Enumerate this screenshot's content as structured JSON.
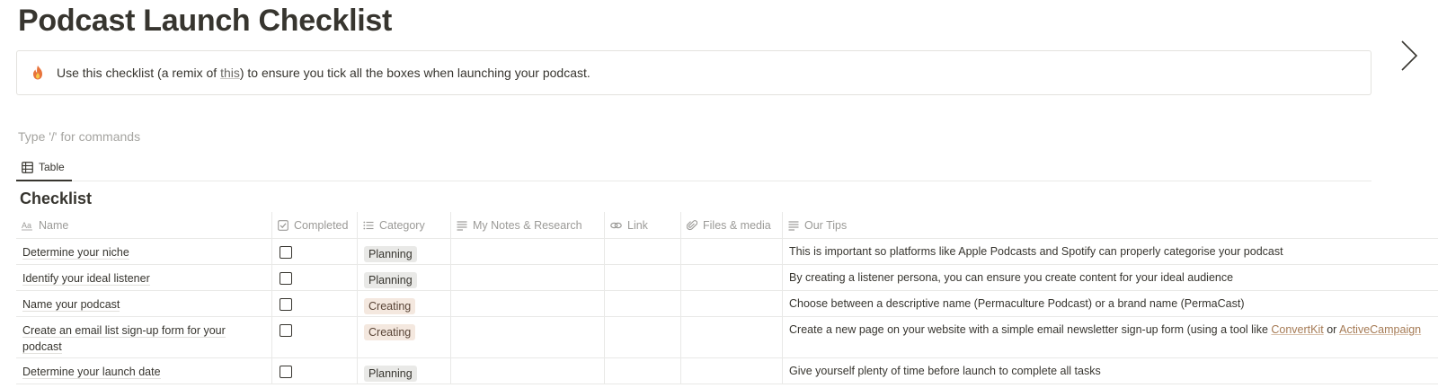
{
  "page": {
    "title": "Podcast Launch Checklist"
  },
  "callout": {
    "icon": "fire-icon",
    "text_before": "Use this checklist (a remix of ",
    "link_text": "this",
    "text_after": ") to ensure you tick all the boxes when launching your podcast."
  },
  "editor": {
    "placeholder": "Type '/' for commands"
  },
  "views": {
    "active_tab_label": "Table"
  },
  "database": {
    "title": "Checklist",
    "columns": [
      {
        "label": "Name",
        "icon": "text-aa-icon"
      },
      {
        "label": "Completed",
        "icon": "checkbox-icon"
      },
      {
        "label": "Category",
        "icon": "list-icon"
      },
      {
        "label": "My Notes & Research",
        "icon": "text-lines-icon"
      },
      {
        "label": "Link",
        "icon": "link-icon"
      },
      {
        "label": "Files & media",
        "icon": "paperclip-icon"
      },
      {
        "label": "Our Tips",
        "icon": "text-lines-icon"
      }
    ],
    "rows": [
      {
        "name": "Determine your niche",
        "completed": false,
        "category": "Planning",
        "tip": "This is important so platforms like Apple Podcasts and Spotify can properly categorise your podcast"
      },
      {
        "name": "Identify your ideal listener",
        "completed": false,
        "category": "Planning",
        "tip": "By creating a listener persona, you can ensure you create content for your ideal audience"
      },
      {
        "name": "Name your podcast",
        "completed": false,
        "category": "Creating",
        "tip": "Choose between a descriptive name (Permaculture Podcast) or a brand name (PermaCast)"
      },
      {
        "name": "Create an email list sign-up form for your podcast",
        "completed": false,
        "category": "Creating",
        "tip_before": "Create a new page on your website with a simple email newsletter sign-up form (using a tool like ",
        "tip_link1": "ConvertKit",
        "tip_mid": " or ",
        "tip_link2": "ActiveCampaign"
      },
      {
        "name": "Determine your launch date",
        "completed": false,
        "category": "Planning",
        "tip": "Give yourself plenty of time before launch to complete all tasks"
      }
    ]
  },
  "colors": {
    "text": "#37352f",
    "muted": "#9b9a97",
    "planning_tag_bg": "#e9e9e7",
    "creating_tag_bg": "#f4e8df",
    "link_brown": "#a57a54"
  }
}
